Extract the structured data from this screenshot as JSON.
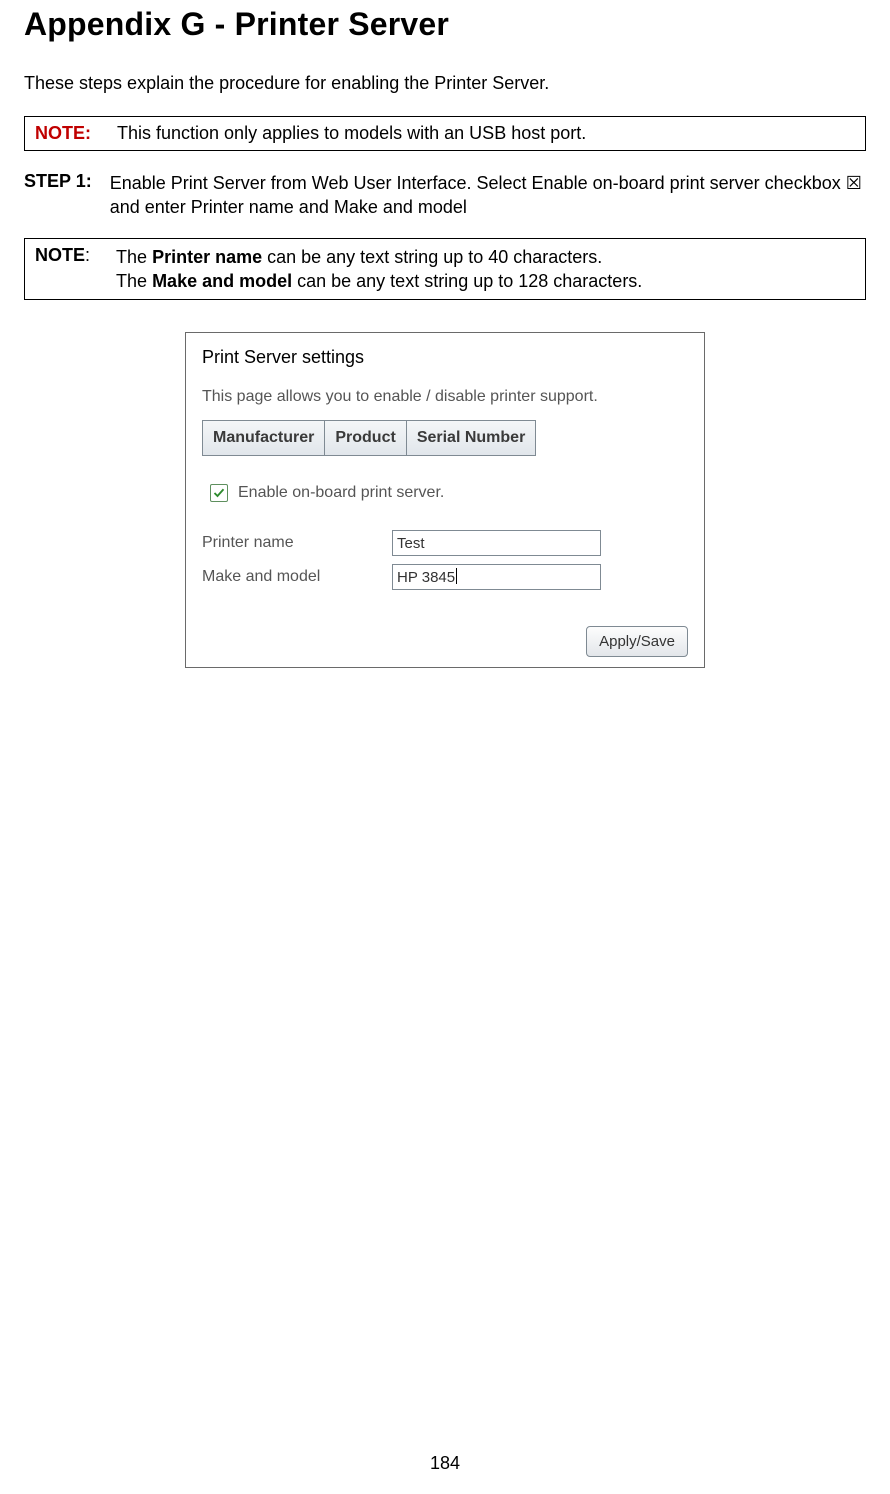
{
  "heading": "Appendix G - Printer Server",
  "intro": "These steps explain the procedure for enabling the Printer Server.",
  "note1": {
    "label": "NOTE:",
    "text": "This function only applies to models with an USB host port."
  },
  "step1": {
    "label": "STEP 1:",
    "text": "Enable Print Server from Web User Interface. Select Enable on-board print server checkbox ☒ and enter Printer name and Make and model"
  },
  "note2": {
    "label": "NOTE",
    "colon": ":",
    "line1_pre": "The ",
    "line1_b": "Printer name",
    "line1_post": " can be any text string up to 40 characters.",
    "line2_pre": "The ",
    "line2_b": "Make and model",
    "line2_post": " can be any text string up to 128 characters."
  },
  "inset": {
    "title": "Print Server settings",
    "desc": "This page allows you to enable / disable printer support.",
    "tabs": [
      "Manufacturer",
      "Product",
      "Serial Number"
    ],
    "checkbox_label": "Enable on-board print server.",
    "checkbox_checked": true,
    "rows": {
      "printer_name": {
        "label": "Printer name",
        "value": "Test"
      },
      "make_model": {
        "label": "Make and model",
        "value": "HP 3845"
      }
    },
    "apply_label": "Apply/Save"
  },
  "page_number": "184"
}
